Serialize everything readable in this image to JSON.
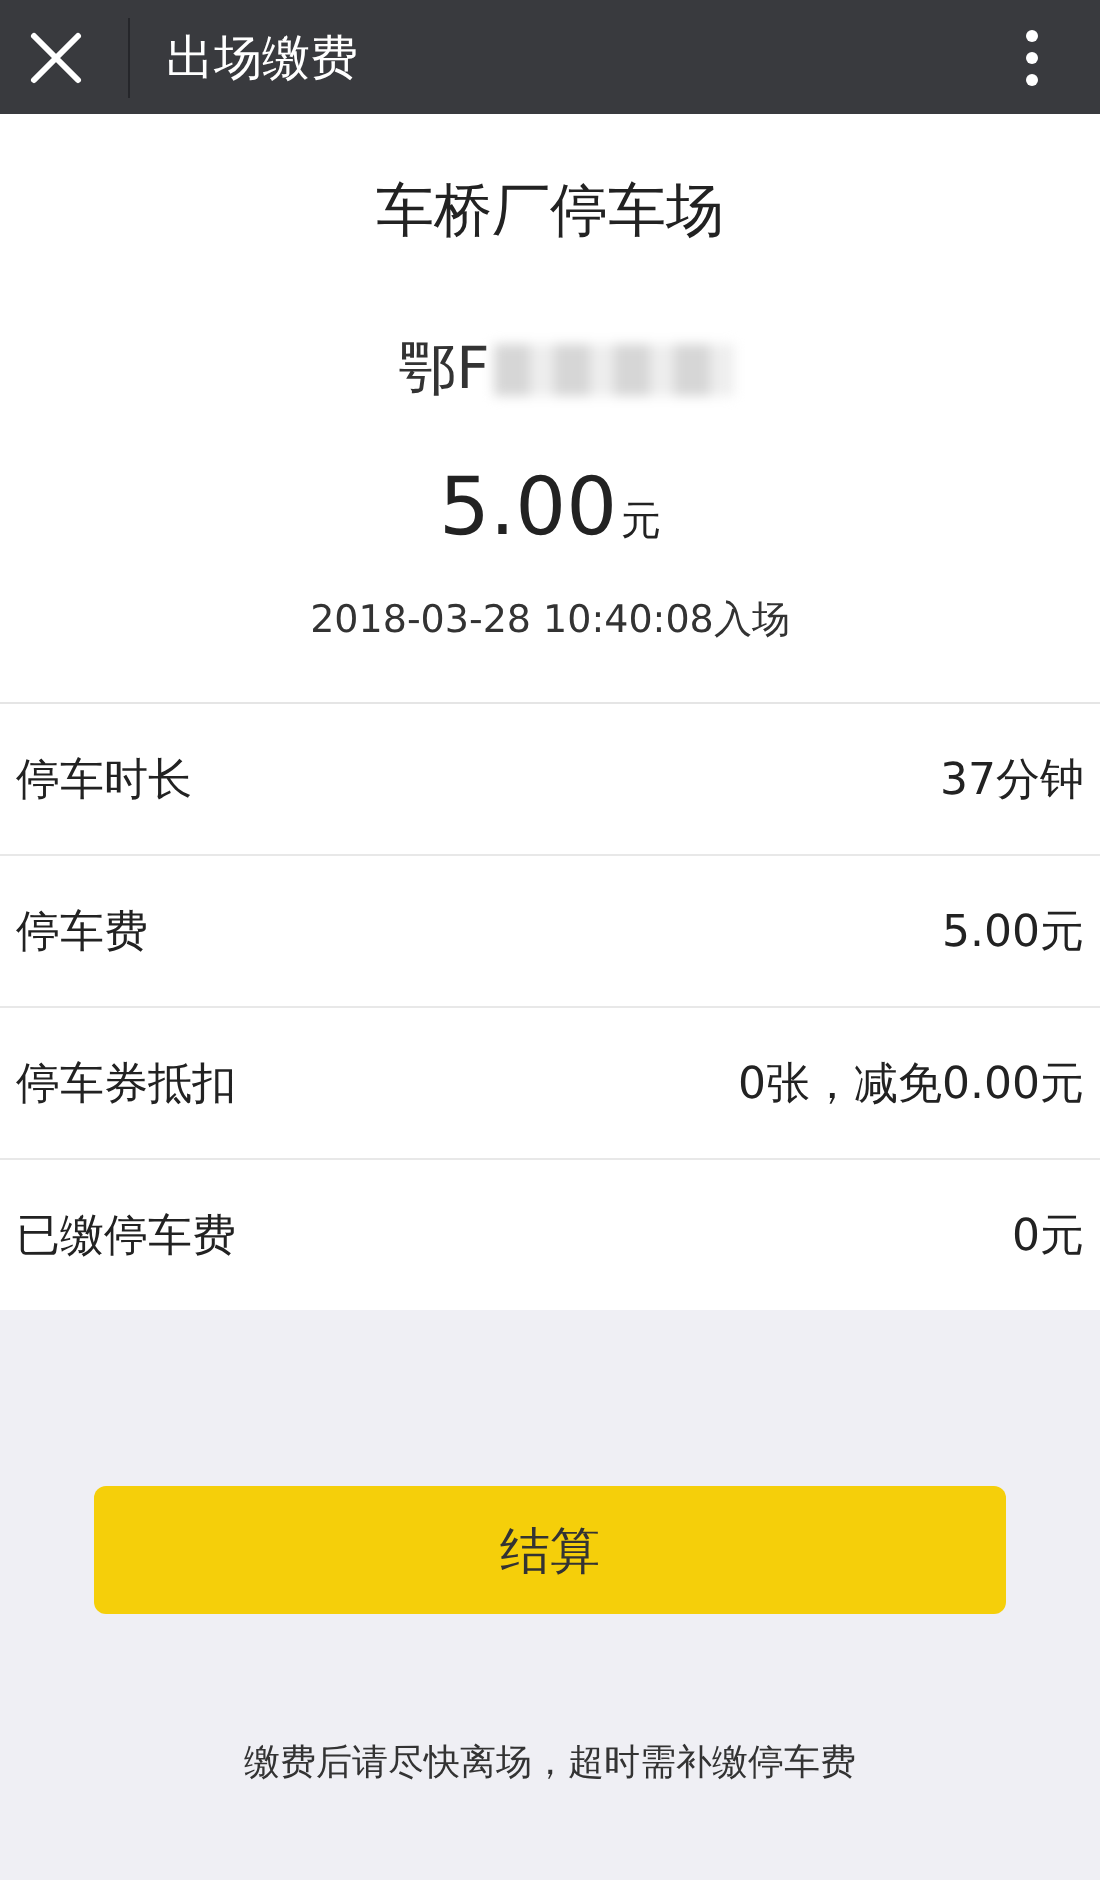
{
  "header": {
    "title": "出场缴费"
  },
  "summary": {
    "lot_name": "车桥厂停车场",
    "plate": "鄂F",
    "amount": "5.00",
    "unit": "元",
    "entry_time": "2018-03-28 10:40:08入场"
  },
  "rows": [
    {
      "label": "停车时长",
      "value": "37分钟"
    },
    {
      "label": "停车费",
      "value": "5.00元"
    },
    {
      "label": "停车券抵扣",
      "value": "0张，减免0.00元"
    },
    {
      "label": "已缴停车费",
      "value": "0元"
    }
  ],
  "button": {
    "label": "结算"
  },
  "notice": "缴费后请尽快离场，超时需补缴停车费"
}
